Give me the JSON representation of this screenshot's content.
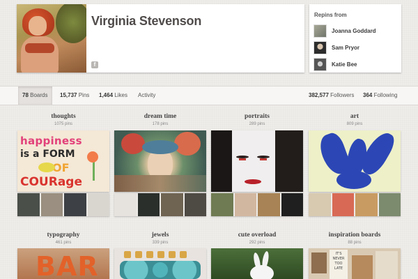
{
  "profile": {
    "name": "Virginia Stevenson"
  },
  "repins": {
    "title": "Repins from",
    "people": [
      {
        "name": "Joanna Goddard",
        "avatar_color": "#8b8f84"
      },
      {
        "name": "Sam Pryor",
        "avatar_color": "#3f3f3f"
      },
      {
        "name": "Katie Bee",
        "avatar_color": "#6b6b6b"
      }
    ]
  },
  "stats": {
    "boards_count": "78",
    "boards_label": "Boards",
    "pins_count": "15,737",
    "pins_label": "Pins",
    "likes_count": "1,464",
    "likes_label": "Likes",
    "activity_label": "Activity",
    "followers_count": "382,577",
    "followers_label": "Followers",
    "following_count": "364",
    "following_label": "Following"
  },
  "boards": [
    {
      "title": "thoughts",
      "pins": "1075 pins",
      "cover_text": [
        "happiness",
        "is a FORM",
        "OF",
        "COURage"
      ],
      "thumb_colors": [
        "#4a4f4a",
        "#9a8f80",
        "#3d4044",
        "#d9d6d0"
      ]
    },
    {
      "title": "dream time",
      "pins": "178 pins",
      "thumb_colors": [
        "#e6e2de",
        "#2b2f2c",
        "#6f6452",
        "#4e4a44"
      ]
    },
    {
      "title": "portraits",
      "pins": "289 pins",
      "thumb_colors": [
        "#6f7b52",
        "#d2b7a0",
        "#a88355",
        "#1f1f1f"
      ]
    },
    {
      "title": "art",
      "pins": "809 pins",
      "thumb_colors": [
        "#d7cab0",
        "#d86a55",
        "#c89b62",
        "#7c8a6e"
      ]
    },
    {
      "title": "typography",
      "pins": "461 pins",
      "cover_text": [
        "BAR"
      ]
    },
    {
      "title": "jewels",
      "pins": "339 pins"
    },
    {
      "title": "cute overload",
      "pins": "292 pins"
    },
    {
      "title": "inspiration boards",
      "pins": "88 pins",
      "cover_text": [
        "IT'S",
        "NEVER",
        "TOO",
        "LATE"
      ]
    }
  ]
}
